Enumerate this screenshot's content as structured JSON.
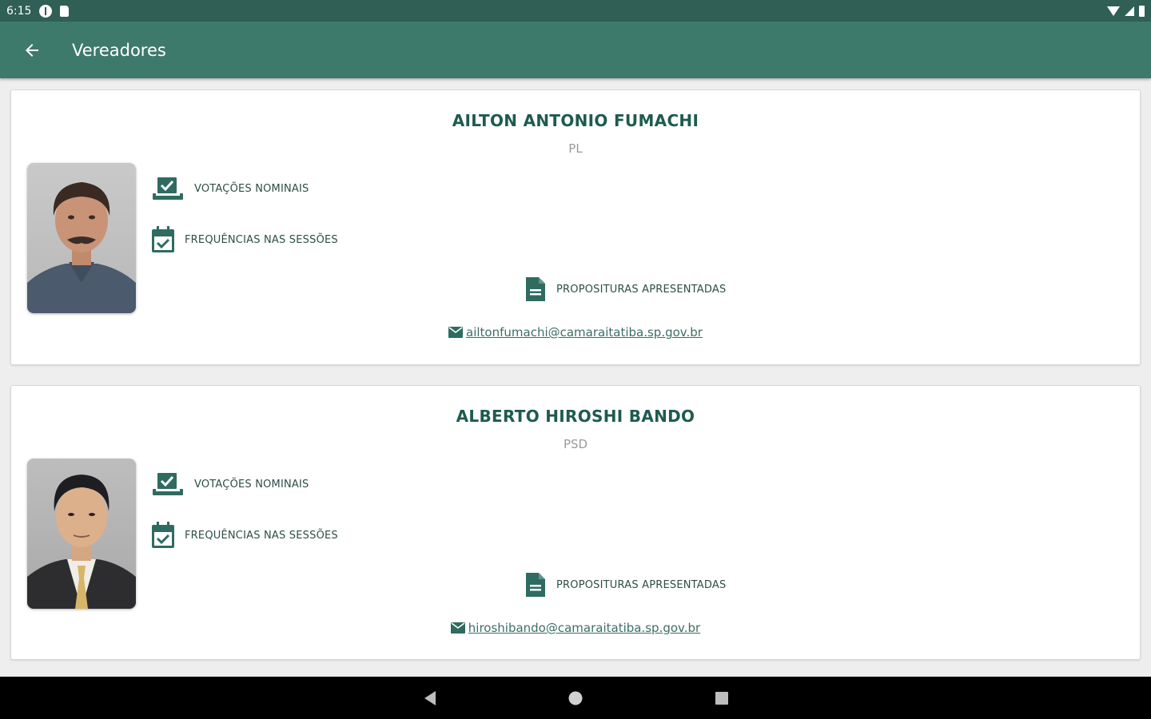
{
  "status_bar": {
    "time": "6:15"
  },
  "app_bar": {
    "title": "Vereadores"
  },
  "councilors": [
    {
      "name": "AILTON ANTONIO FUMACHI",
      "party": "PL",
      "votacoes_label": "VOTAÇÕES NOMINAIS",
      "frequencias_label": "FREQUÊNCIAS NAS SESSÕES",
      "proposituras_label": "PROPOSITURAS APRESENTADAS",
      "email": "ailtonfumachi@camaraitatiba.sp.gov.br"
    },
    {
      "name": "ALBERTO HIROSHI BANDO",
      "party": "PSD",
      "votacoes_label": "VOTAÇÕES NOMINAIS",
      "frequencias_label": "FREQUÊNCIAS NAS SESSÕES",
      "proposituras_label": "PROPOSITURAS APRESENTADAS",
      "email": "hiroshibando@camaraitatiba.sp.gov.br"
    }
  ],
  "colors": {
    "primary": "#3d7a6c",
    "primary_dark": "#2f5f55",
    "accent_text": "#1e5b4f",
    "icon": "#2f6b60"
  },
  "icons": {
    "back": "arrow-back-icon",
    "votacoes": "ballot-box-icon",
    "frequencias": "calendar-check-icon",
    "proposituras": "document-icon",
    "email": "envelope-icon"
  }
}
